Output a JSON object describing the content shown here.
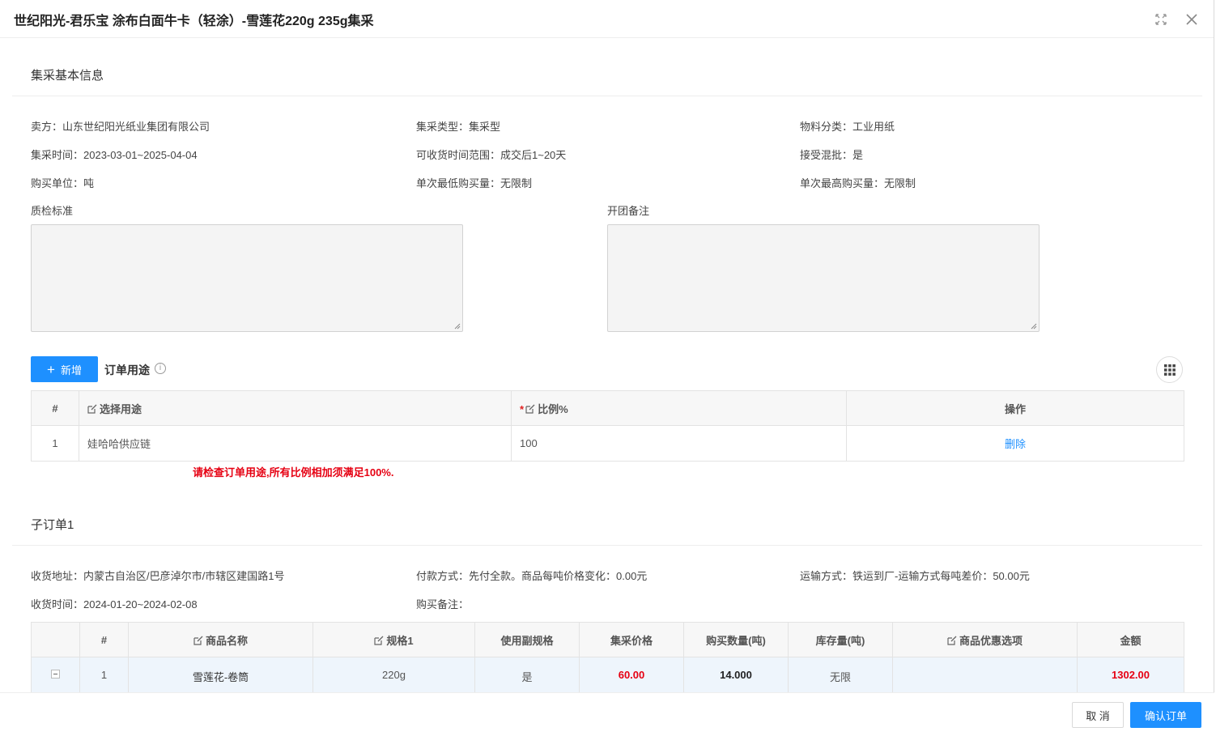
{
  "modal": {
    "title": "世纪阳光-君乐宝 涂布白面牛卡（轻涂）-雪莲花220g 235g集采",
    "expand_icon": "fullscreen-icon",
    "close_icon": "close-icon"
  },
  "basic": {
    "section_title": "集采基本信息",
    "seller": "卖方：山东世纪阳光纸业集团有限公司",
    "type": "集采类型：集采型",
    "category": "物料分类：工业用纸",
    "time": "集采时间：2023-03-01~2025-04-04",
    "delivery_range": "可收货时间范围：成交后1~20天",
    "mixed": "接受混批：是",
    "unit": "购买单位：吨",
    "min_qty": "单次最低购买量：无限制",
    "max_qty": "单次最高购买量：无限制",
    "qc_label": "质检标准",
    "remark_label": "开团备注"
  },
  "usage": {
    "add_button": "新增",
    "title": "订单用途",
    "columns": [
      "#",
      "选择用途",
      "比例%",
      "操作"
    ],
    "rows": [
      {
        "index": "1",
        "usage": "娃哈哈供应链",
        "ratio": "100",
        "action": "删除"
      }
    ],
    "error": "请检查订单用途,所有比例相加须满足100%."
  },
  "suborder": {
    "section_title": "子订单1",
    "address": "收货地址：内蒙古自治区/巴彦淖尔市/市辖区建国路1号",
    "payment": "付款方式：先付全款。商品每吨价格变化：0.00元",
    "transport": "运输方式：铁运到厂-运输方式每吨差价：50.00元",
    "receive_time": "收货时间：2024-01-20~2024-02-08",
    "note": "购买备注："
  },
  "goods": {
    "columns": [
      "",
      "#",
      "商品名称",
      "规格1",
      "使用副规格",
      "集采价格",
      "购买数量(吨)",
      "库存量(吨)",
      "商品优惠选项",
      "金额"
    ],
    "rows": [
      {
        "index": "1",
        "name": "雪莲花-卷筒",
        "spec": "220g",
        "use_sub": "是",
        "price": "60.00",
        "qty": "14.000",
        "stock": "无限",
        "discount": "",
        "amount": "1302.00"
      }
    ]
  },
  "footer": {
    "cancel": "取 消",
    "confirm": "确认订单"
  }
}
